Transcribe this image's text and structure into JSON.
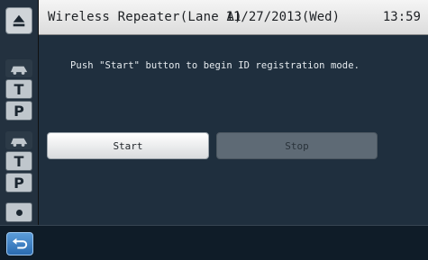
{
  "header": {
    "title": "Wireless Repeater(Lane A)",
    "date": "11/27/2013(Wed)",
    "time": "13:59"
  },
  "main": {
    "message": "Push \"Start\" button to begin ID registration mode.",
    "start_label": "Start",
    "stop_label": "Stop"
  },
  "sidebar": {
    "groups": [
      {
        "items": [
          "car-icon",
          "T",
          "P"
        ]
      },
      {
        "items": [
          "car-icon",
          "T",
          "P"
        ]
      }
    ],
    "dot": "dot-icon"
  },
  "footer": {
    "back_icon": "return-arrow-icon"
  },
  "colors": {
    "titlebar": "#e8e8e8",
    "background": "#1f2f3e",
    "start_button": "#f1f2f3",
    "stop_button": "#5e6a75",
    "back_button": "#3c82c6"
  }
}
